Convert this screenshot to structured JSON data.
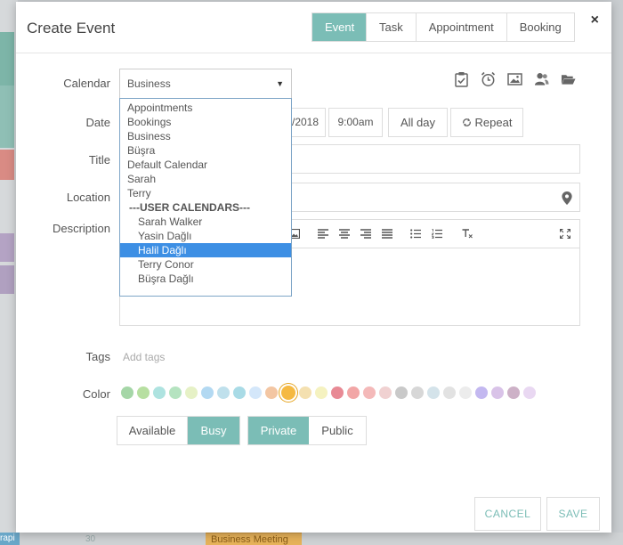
{
  "modal": {
    "title": "Create Event",
    "close_symbol": "×",
    "tabs": [
      {
        "label": "Event",
        "active": true
      },
      {
        "label": "Task",
        "active": false
      },
      {
        "label": "Appointment",
        "active": false
      },
      {
        "label": "Booking",
        "active": false
      }
    ]
  },
  "form": {
    "labels": {
      "calendar": "Calendar",
      "date": "Date",
      "title": "Title",
      "location": "Location",
      "description": "Description",
      "tags": "Tags",
      "color": "Color"
    },
    "calendar_selected": "Business",
    "date_value": "/2018",
    "time_value": "9:00am",
    "allday_label": "All day",
    "repeat_label": "Repeat",
    "tags_placeholder": "Add tags",
    "availability": [
      {
        "label": "Available",
        "active": false
      },
      {
        "label": "Busy",
        "active": true
      }
    ],
    "visibility": [
      {
        "label": "Private",
        "active": true
      },
      {
        "label": "Public",
        "active": false
      }
    ],
    "colors": [
      "#a5d6a7",
      "#b7dfa1",
      "#aee3e0",
      "#b5e3c0",
      "#e6f1c6",
      "#b3d9f2",
      "#bfe0ec",
      "#a9dbe6",
      "#d4e7fa",
      "#f3c6a3",
      "#f5b942",
      "#f4e0b0",
      "#f5f2c0",
      "#e88a95",
      "#f2a6a6",
      "#f4b9b9",
      "#f0d1d1",
      "#c9c9c9",
      "#d7d7d7",
      "#d4e3ea",
      "#e2e2e2",
      "#ececec",
      "#c3b8f0",
      "#d9c3e8",
      "#cdb1c7",
      "#e9d8f2"
    ],
    "selected_color_index": 10
  },
  "calendar_dropdown": {
    "items": [
      {
        "label": "Appointments",
        "kind": "item"
      },
      {
        "label": "Bookings",
        "kind": "item"
      },
      {
        "label": "Business",
        "kind": "item"
      },
      {
        "label": "Büşra",
        "kind": "item"
      },
      {
        "label": "Default Calendar",
        "kind": "item"
      },
      {
        "label": "Sarah",
        "kind": "item"
      },
      {
        "label": "Terry",
        "kind": "item"
      },
      {
        "label": "---USER CALENDARS---",
        "kind": "group"
      },
      {
        "label": "Sarah Walker",
        "kind": "sub"
      },
      {
        "label": "Yasin Dağlı",
        "kind": "sub"
      },
      {
        "label": "Halil Dağlı",
        "kind": "sub",
        "highlighted": true
      },
      {
        "label": "Terry Conor",
        "kind": "sub"
      },
      {
        "label": "Büşra Dağlı",
        "kind": "sub"
      }
    ]
  },
  "footer": {
    "cancel_label": "CANCEL",
    "save_label": "SAVE"
  },
  "background": {
    "event_label": "Business Meeting",
    "day_number": "30",
    "side_label": "rapi"
  },
  "colors": {
    "accent": "#7bbdb6",
    "highlight": "#3d8fe4"
  }
}
